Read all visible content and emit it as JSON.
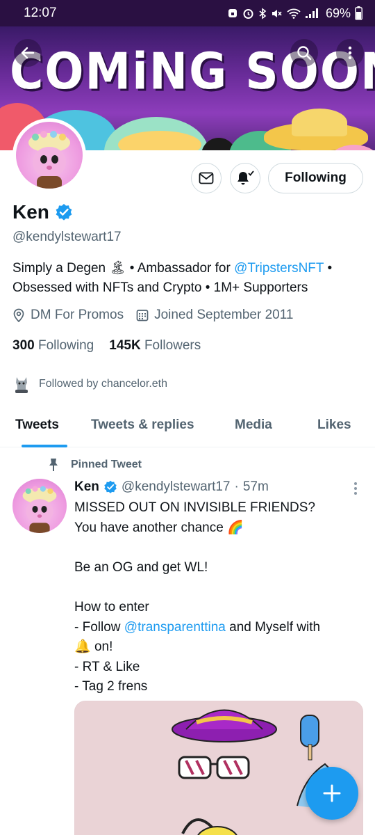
{
  "status_bar": {
    "time": "12:07",
    "battery": "69%"
  },
  "banner": {
    "headline": "COMiNG SOON"
  },
  "profile": {
    "name": "Ken",
    "handle": "@kendylstewart17",
    "bio": {
      "line1_pre": "Simply a Degen ",
      "line1_emoji": "🏝",
      "line1_mid": " • Ambassador for ",
      "line1_link": "@TripstersNFT",
      "line1_post": " •",
      "line2": "Obsessed with NFTs and Crypto • 1M+ Supporters"
    },
    "location": "DM For Promos",
    "joined": "Joined September 2011",
    "following_count": "300",
    "following_label": "Following",
    "followers_count": "145K",
    "followers_label": "Followers",
    "followed_by": "Followed by chancelor.eth",
    "follow_button_label": "Following"
  },
  "tabs": [
    {
      "label": "Tweets",
      "active": true
    },
    {
      "label": "Tweets & replies",
      "active": false
    },
    {
      "label": "Media",
      "active": false
    },
    {
      "label": "Likes",
      "active": false
    }
  ],
  "pinned_tweet": {
    "pinned_label": "Pinned Tweet",
    "author_name": "Ken",
    "author_handle": "@kendylstewart17",
    "separator": "·",
    "time": "57m",
    "lines": {
      "l1": "MISSED OUT ON INVISIBLE FRIENDS?",
      "l2_text": "You have another chance ",
      "l2_emoji": "🌈",
      "l3": "Be an OG and get WL!",
      "l4": "How to enter",
      "l5_pre": "- Follow ",
      "l5_link": "@transparenttina",
      "l5_post": " and Myself with",
      "l6_emoji": "🔔",
      "l6_text": " on!",
      "l7": "- RT & Like",
      "l8": "- Tag 2 frens"
    }
  },
  "colors": {
    "accent": "#1d9bf0",
    "text": "#0f1419",
    "secondary": "#536471",
    "border": "#cfd9de"
  },
  "icons": {
    "back": "arrow-left-icon",
    "search": "search-icon",
    "more": "more-vertical-icon",
    "message": "envelope-icon",
    "notifications": "bell-check-icon",
    "verified": "verified-badge-icon",
    "location": "location-pin-icon",
    "calendar": "calendar-icon",
    "pin": "pin-icon",
    "compose": "plus-icon"
  }
}
